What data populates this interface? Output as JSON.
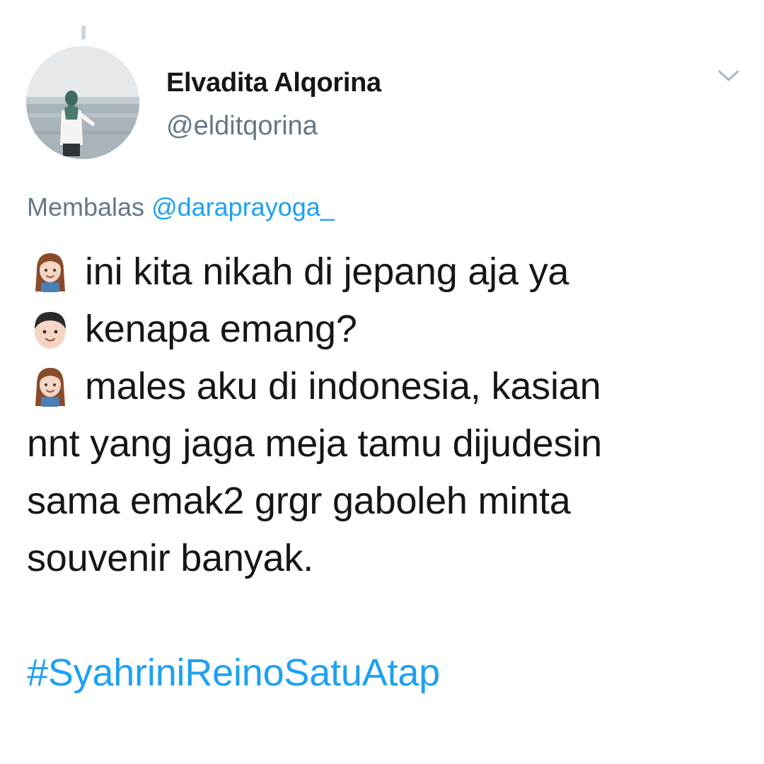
{
  "tweet": {
    "author": {
      "display_name": "Elvadita Alqorina",
      "handle": "@elditqorina",
      "avatar_icon": "profile-photo"
    },
    "menu_icon": "chevron-down-icon",
    "reply_prefix": "Membalas",
    "reply_to": "@daraprayoga_",
    "lines": [
      {
        "emoji": "woman-emoji",
        "text": "ini kita nikah di jepang aja ya"
      },
      {
        "emoji": "boy-emoji",
        "text": "kenapa emang?"
      },
      {
        "emoji": "woman-emoji",
        "text": "males aku di indonesia, kasian"
      },
      {
        "emoji": null,
        "text": "nnt yang jaga meja tamu dijudesin"
      },
      {
        "emoji": null,
        "text": "sama emak2 grgr gaboleh minta"
      },
      {
        "emoji": null,
        "text": "souvenir banyak."
      }
    ],
    "hashtag": "#SyahriniReinoSatuAtap"
  },
  "colors": {
    "link": "#1da1f2",
    "secondary_text": "#657786",
    "primary_text": "#14171a"
  }
}
